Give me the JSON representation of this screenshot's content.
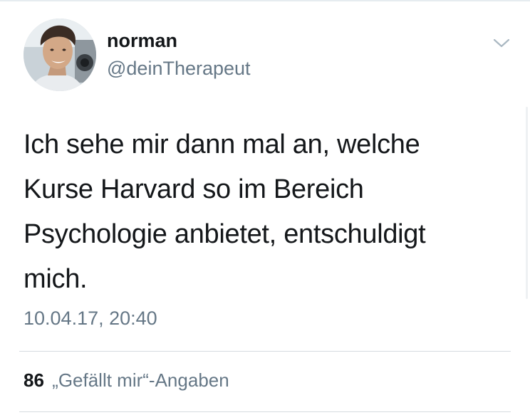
{
  "tweet": {
    "author": {
      "display_name": "norman",
      "handle": "@deinTherapeut",
      "avatar_icon": "profile-photo"
    },
    "text": "Ich sehe mir dann mal an, welche Kurse Harvard so im Bereich Psychologie anbietet, entschuldigt mich.",
    "timestamp": "10.04.17, 20:40",
    "likes": {
      "count": "86",
      "label": "„Gefällt mir“-Angaben"
    },
    "menu_icon": "chevron-down-icon"
  },
  "colors": {
    "text_primary": "#14171a",
    "text_secondary": "#657786",
    "divider": "#d5dbe0",
    "chevron": "#aab8c2"
  }
}
